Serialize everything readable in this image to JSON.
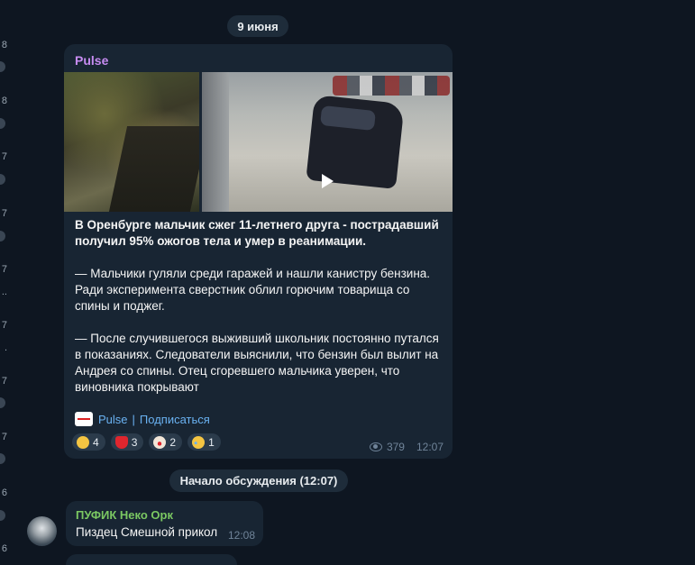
{
  "left_strip": {
    "nums": [
      "8",
      "8",
      "7",
      "7",
      "7",
      "7",
      "7",
      "7",
      "6",
      "6"
    ],
    "marks": [
      "..",
      "."
    ]
  },
  "date": "9 июня",
  "post": {
    "channel": "Pulse",
    "title": "В Оренбурге мальчик сжег 11-летнего друга - пострадавший получил 95% ожогов тела и умер в реанимации.",
    "paragraph1": "— Мальчики гуляли среди гаражей и нашли канистру бензина. Ради эксперимента сверстник облил горючим товарища со спины и поджег.",
    "paragraph2": "— После случившегося выживший школьник постоянно путался в показаниях. Следователи выяснили, что бензин был вылит на Андрея со спины. Отец сгоревшего мальчика уверен, что виновника покрывают",
    "signature": {
      "name": "Pulse",
      "separator": "|",
      "subscribe": "Подписаться"
    },
    "reactions": [
      {
        "icon": "scream-emoji-icon",
        "color": "#f4c542",
        "count": "4"
      },
      {
        "icon": "heart-emoji-icon",
        "color": "#e0262e",
        "count": "3"
      },
      {
        "icon": "clown-emoji-icon",
        "color": "#f2e6d8",
        "count": "2"
      },
      {
        "icon": "cry-emoji-icon",
        "color": "#f4c542",
        "count": "1"
      }
    ],
    "views": "379",
    "time": "12:07"
  },
  "discussion_start": "Начало обсуждения (12:07)",
  "comment": {
    "author": "ПУФИК Неко Орк",
    "text": "Пиздец Смешной прикол",
    "time": "12:08",
    "avatar_icon": "husky-avatar-icon"
  },
  "colors": {
    "bg": "#0e1621",
    "bubble": "#182533",
    "accent": "#6ab2f2",
    "channel": "#c78cf2",
    "author": "#7bc862"
  }
}
